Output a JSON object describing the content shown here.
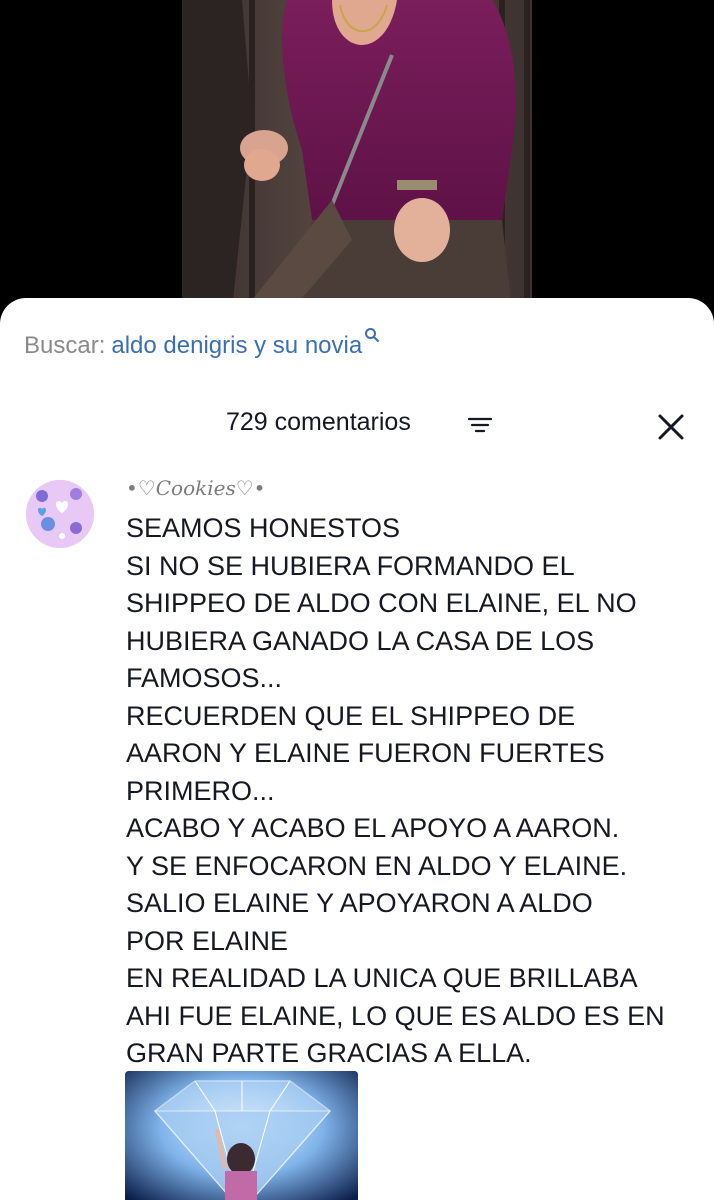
{
  "search": {
    "label": "Buscar:",
    "query": "aldo denigris y su novia",
    "icon": "search-icon"
  },
  "comments_header": {
    "count_label": "729 comentarios",
    "filter_icon": "filter-icon",
    "close_icon": "close-icon"
  },
  "comment": {
    "username": "•♡Cookies♡•",
    "lines": [
      "SEAMOS HONESTOS",
      "SI NO SE HUBIERA FORMANDO EL",
      "SHIPPEO DE ALDO CON ELAINE, EL NO",
      "HUBIERA GANADO LA CASA DE LOS",
      "FAMOSOS...",
      "RECUERDEN QUE EL SHIPPEO DE",
      "AARON Y ELAINE FUERON FUERTES",
      "PRIMERO...",
      "ACABO Y ACABO EL APOYO A AARON.",
      "Y SE ENFOCARON EN ALDO Y ELAINE.",
      "SALIO ELAINE Y APOYARON A ALDO",
      "POR ELAINE",
      "EN REALIDAD LA UNICA QUE BRILLABA",
      "AHI FUE ELAINE, LO QUE ES ALDO ES EN",
      "GRAN PARTE GRACIAS A ELLA."
    ]
  },
  "colors": {
    "background": "#000000",
    "sheet": "#ffffff",
    "search_label": "#8a8a8a",
    "search_query": "#3b6fb3",
    "text": "#161823",
    "username": "#7c7c7c"
  }
}
